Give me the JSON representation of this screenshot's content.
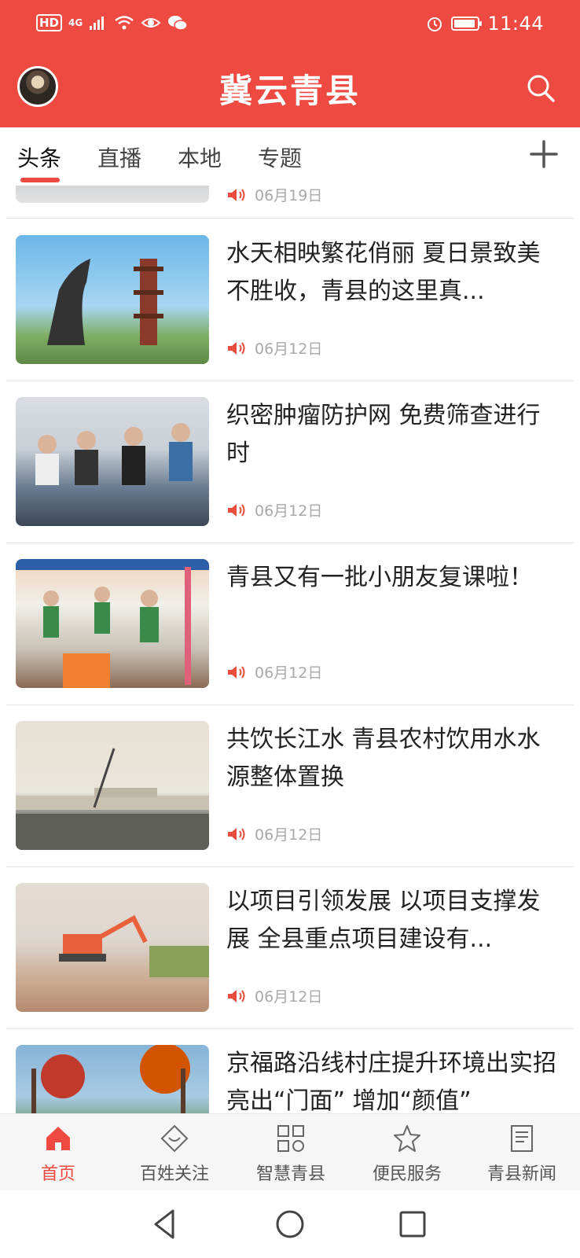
{
  "status_bar": {
    "hd": "HD",
    "network": "4G",
    "time": "11:44"
  },
  "header": {
    "title": "冀云青县",
    "avatar_icon": "avatar-icon",
    "search_icon": "search-icon",
    "brand_color": "#ee4a42"
  },
  "tabs": [
    {
      "label": "头条",
      "active": true
    },
    {
      "label": "直播",
      "active": false
    },
    {
      "label": "本地",
      "active": false
    },
    {
      "label": "专题",
      "active": false
    }
  ],
  "feed": {
    "partial_item": {
      "date": "06月19日"
    },
    "items": [
      {
        "title": "水天相映繁花俏丽 夏日景致美不胜收，青县的这里真...",
        "date": "06月12日"
      },
      {
        "title": "织密肿瘤防护网 免费筛查进行时",
        "date": "06月12日"
      },
      {
        "title": "青县又有一批小朋友复课啦！",
        "date": "06月12日"
      },
      {
        "title": "共饮长江水 青县农村饮用水水源整体置换",
        "date": "06月12日"
      },
      {
        "title": "以项目引领发展 以项目支撑发展 全县重点项目建设有...",
        "date": "06月12日"
      },
      {
        "title": "京福路沿线村庄提升环境出实招 亮出“门面” 增加“颜值”",
        "date": ""
      }
    ]
  },
  "bottom_nav": [
    {
      "label": "首页",
      "icon": "home-icon",
      "active": true
    },
    {
      "label": "百姓关注",
      "icon": "heart-diamond-icon",
      "active": false
    },
    {
      "label": "智慧青县",
      "icon": "grid-icon",
      "active": false
    },
    {
      "label": "便民服务",
      "icon": "star-icon",
      "active": false
    },
    {
      "label": "青县新闻",
      "icon": "news-icon",
      "active": false
    }
  ]
}
